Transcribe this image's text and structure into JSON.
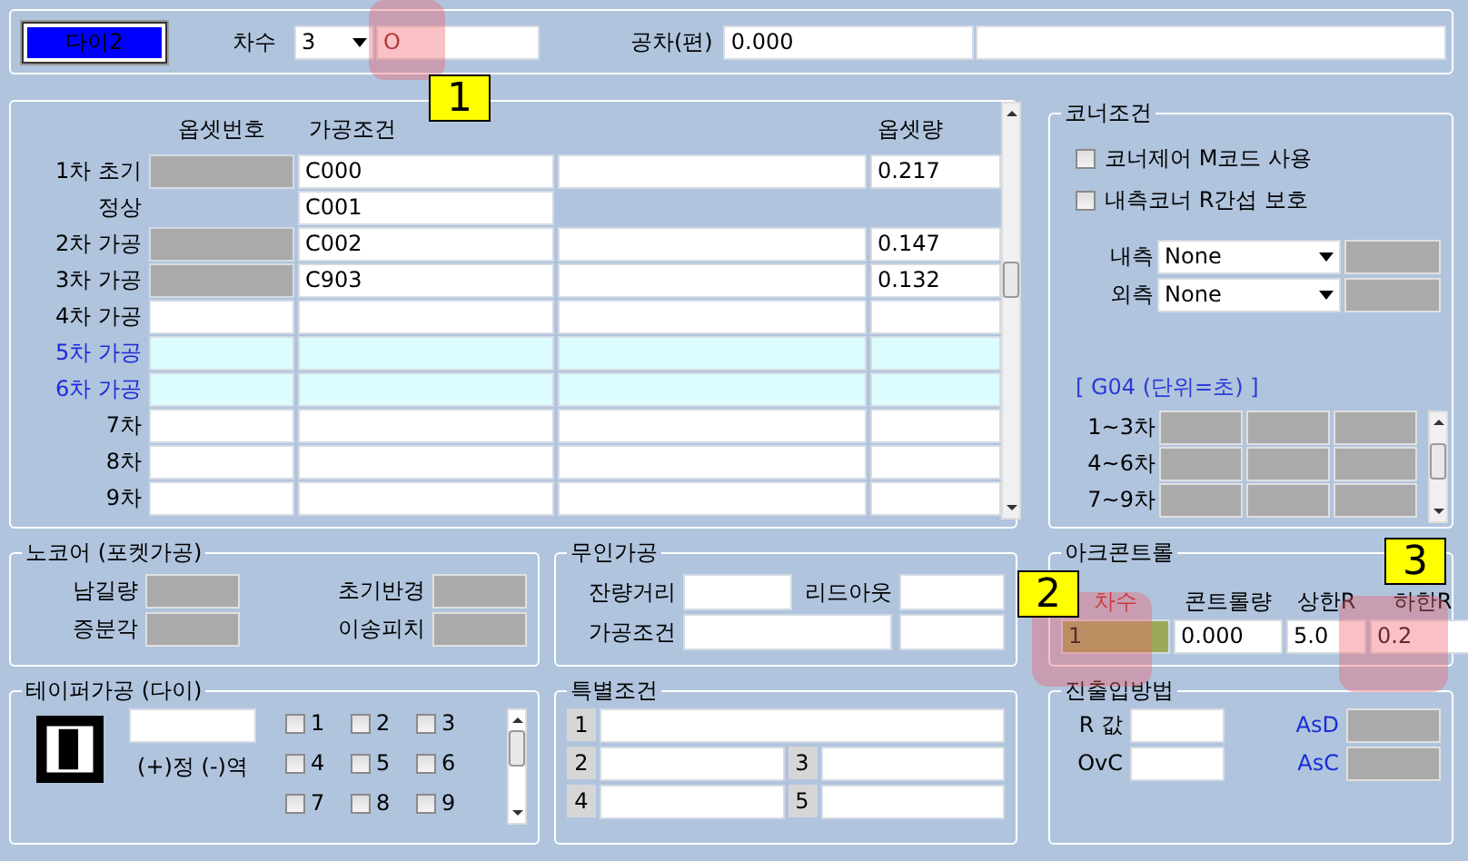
{
  "top_bar": {
    "die_button": "다이2",
    "order_label": "차수",
    "order_select": "3",
    "order_field": "O",
    "tolerance_label": "공차(편)",
    "tolerance_field": "0.000"
  },
  "process_table": {
    "columns": [
      "옵셋번호",
      "가공조건",
      "옵셋량"
    ],
    "rows": [
      {
        "label": "1차 초기",
        "kind": "main",
        "offset_disabled": true,
        "condition": "C000",
        "amount": "0.217",
        "highlighted": false
      },
      {
        "label": "정상",
        "kind": "sub",
        "condition": "C001",
        "highlighted": false
      },
      {
        "label": "2차 가공",
        "kind": "main",
        "offset_disabled": true,
        "condition": "C002",
        "amount": "0.147",
        "highlighted": false
      },
      {
        "label": "3차 가공",
        "kind": "main",
        "offset_disabled": true,
        "condition": "C903",
        "amount": "0.132",
        "highlighted": false
      },
      {
        "label": "4차 가공",
        "kind": "main",
        "offset_disabled": false,
        "highlighted": false
      },
      {
        "label": "5차 가공",
        "kind": "main",
        "offset_disabled": false,
        "highlighted": true
      },
      {
        "label": "6차 가공",
        "kind": "main",
        "offset_disabled": false,
        "highlighted": true
      },
      {
        "label": "7차",
        "kind": "main",
        "offset_disabled": false,
        "highlighted": false
      },
      {
        "label": "8차",
        "kind": "main",
        "offset_disabled": false,
        "highlighted": false
      },
      {
        "label": "9차",
        "kind": "main",
        "offset_disabled": false,
        "highlighted": false
      }
    ]
  },
  "corner": {
    "title": "코너조건",
    "checkboxes": [
      {
        "label": "코너제어  M코드 사용",
        "checked": false
      },
      {
        "label": "내측코너  R간섭 보호",
        "checked": false
      }
    ],
    "selects": [
      {
        "label": "내측",
        "value": "None"
      },
      {
        "label": "외측",
        "value": "None"
      }
    ],
    "g04_title": "[   G04 (단위=초)  ]",
    "g04_rows": [
      "1~3차",
      "4~6차",
      "7~9차"
    ]
  },
  "nocore": {
    "title": "노코어 (포켓가공)",
    "left_labels": [
      "남길량",
      "증분각"
    ],
    "right_labels": [
      "초기반경",
      "이송피치"
    ]
  },
  "unmanned": {
    "title": "무인가공",
    "remain_label": "잔량거리",
    "leadout_label": "리드아웃",
    "condition_label": "가공조건"
  },
  "arc_control": {
    "title": "아크콘트롤",
    "columns": [
      {
        "header": "차수",
        "value": "1",
        "selected": true
      },
      {
        "header": "콘트롤량",
        "value": "0.000",
        "selected": false
      },
      {
        "header": "상한R",
        "value": "5.0",
        "selected": false
      },
      {
        "header": "하한R",
        "value": "0.2",
        "selected": false
      }
    ]
  },
  "taper": {
    "title": "테이퍼가공 (다이)",
    "sign_label": "(+)정  (-)역",
    "checkboxes": [
      {
        "label": "1",
        "checked": false
      },
      {
        "label": "2",
        "checked": false
      },
      {
        "label": "3",
        "checked": false
      },
      {
        "label": "4",
        "checked": false
      },
      {
        "label": "5",
        "checked": false
      },
      {
        "label": "6",
        "checked": false
      },
      {
        "label": "7",
        "checked": false
      },
      {
        "label": "8",
        "checked": false
      },
      {
        "label": "9",
        "checked": false
      }
    ]
  },
  "special": {
    "title": "특별조건",
    "numbers": [
      "1",
      "2",
      "3",
      "4",
      "5"
    ]
  },
  "entry": {
    "title": "진출입방법",
    "left_labels": [
      "R 값",
      "OvC"
    ],
    "right_labels": [
      "AsD",
      "AsC"
    ]
  },
  "annotations": [
    "1",
    "2",
    "3"
  ]
}
